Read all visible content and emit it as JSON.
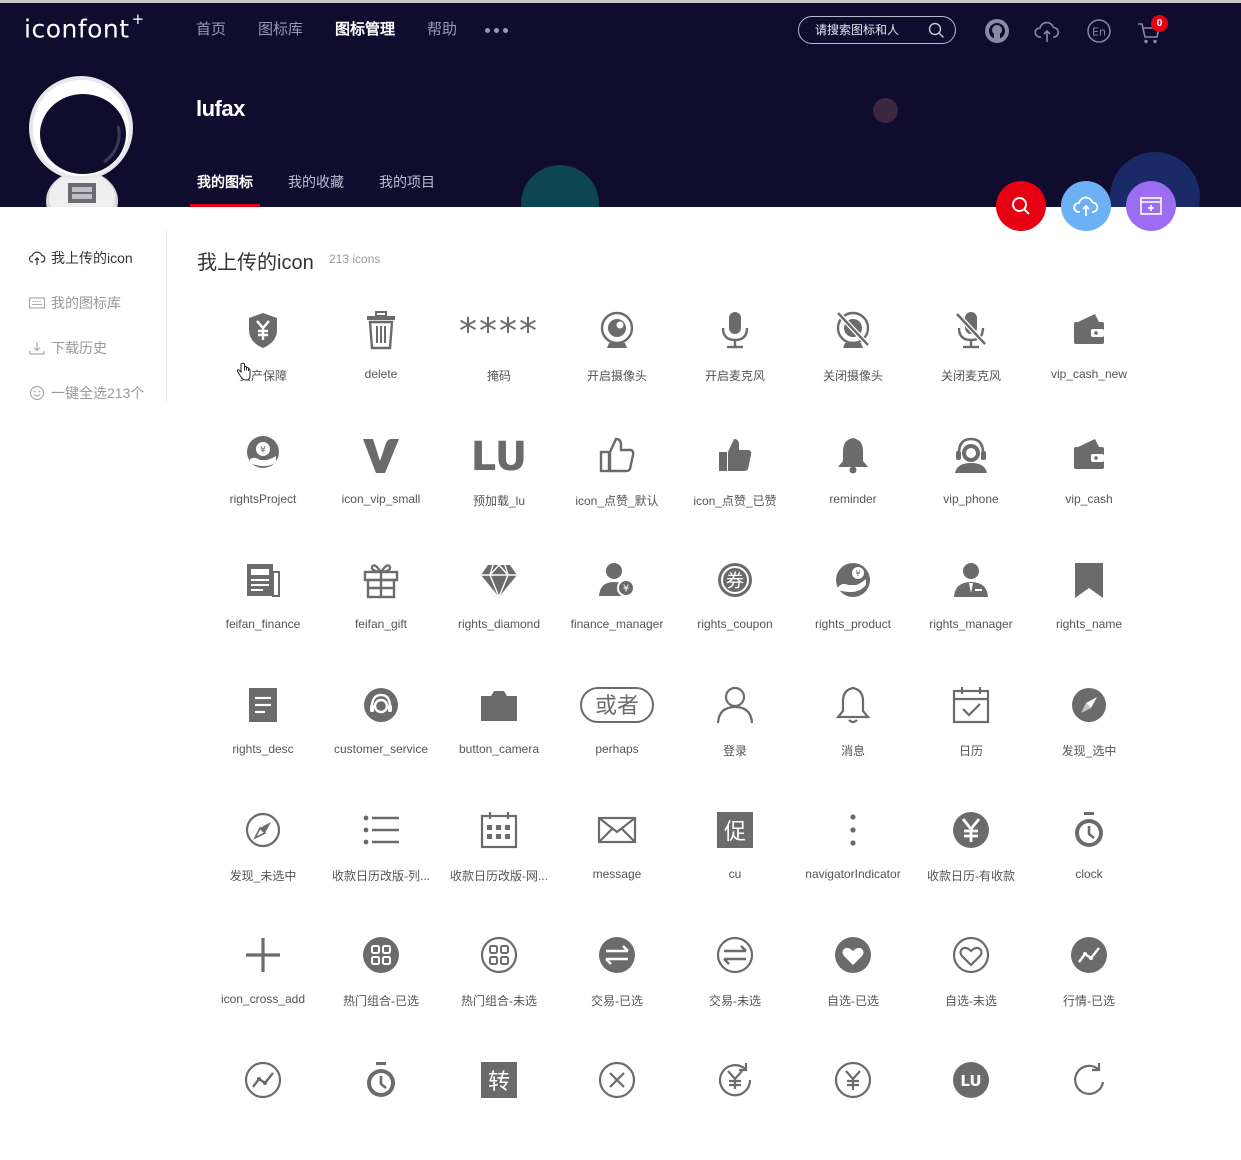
{
  "header": {
    "logo": "iconfont",
    "logo_plus": "+",
    "nav": [
      {
        "label": "首页",
        "active": false
      },
      {
        "label": "图标库",
        "active": false
      },
      {
        "label": "图标管理",
        "active": true
      },
      {
        "label": "帮助",
        "active": false
      }
    ],
    "search_placeholder": "请搜索图标和人",
    "cart_count": "0",
    "icons": [
      "user-circle-icon",
      "cloud-upload-icon",
      "language-en-icon",
      "cart-icon"
    ]
  },
  "profile": {
    "username": "lufax",
    "tabs": [
      {
        "label": "我的图标",
        "active": true
      },
      {
        "label": "我的收藏",
        "active": false
      },
      {
        "label": "我的项目",
        "active": false
      }
    ]
  },
  "fabs": [
    {
      "icon": "search-icon",
      "color": "#e60012"
    },
    {
      "icon": "cloud-upload-icon",
      "color": "#6cb0f6"
    },
    {
      "icon": "add-project-icon",
      "color": "#9c6cf2"
    }
  ],
  "sidebar": {
    "items": [
      {
        "label": "我上传的icon",
        "icon": "cloud-upload-icon",
        "active": true
      },
      {
        "label": "我的图标库",
        "icon": "keyboard-icon",
        "active": false
      },
      {
        "label": "下载历史",
        "icon": "download-icon",
        "active": false
      },
      {
        "label": "一键全选213个",
        "icon": "smile-icon",
        "active": false
      }
    ]
  },
  "main": {
    "title": "我上传的icon",
    "count": "213 icons",
    "icons": [
      {
        "label": "资产保障",
        "icon": "shield-yen-icon"
      },
      {
        "label": "delete",
        "icon": "trash-icon"
      },
      {
        "label": "掩码",
        "icon": "asterisks-icon"
      },
      {
        "label": "开启摄像头",
        "icon": "camera-on-icon"
      },
      {
        "label": "开启麦克风",
        "icon": "mic-on-icon"
      },
      {
        "label": "关闭摄像头",
        "icon": "camera-off-icon"
      },
      {
        "label": "关闭麦克风",
        "icon": "mic-off-icon"
      },
      {
        "label": "vip_cash_new",
        "icon": "wallet-icon"
      },
      {
        "label": "rightsProject",
        "icon": "hand-yen-icon"
      },
      {
        "label": "icon_vip_small",
        "icon": "vip-v-icon"
      },
      {
        "label": "预加载_lu",
        "icon": "lu-text-icon"
      },
      {
        "label": "icon_点赞_默认",
        "icon": "thumb-up-outline-icon"
      },
      {
        "label": "icon_点赞_已赞",
        "icon": "thumb-up-filled-icon"
      },
      {
        "label": "reminder",
        "icon": "bell-filled-icon"
      },
      {
        "label": "vip_phone",
        "icon": "headset-user-icon"
      },
      {
        "label": "vip_cash",
        "icon": "wallet-icon"
      },
      {
        "label": "feifan_finance",
        "icon": "newspaper-icon"
      },
      {
        "label": "feifan_gift",
        "icon": "gift-icon"
      },
      {
        "label": "rights_diamond",
        "icon": "diamond-icon"
      },
      {
        "label": "finance_manager",
        "icon": "user-yen-icon"
      },
      {
        "label": "rights_coupon",
        "icon": "coupon-icon"
      },
      {
        "label": "rights_product",
        "icon": "hand-yen-circle-icon"
      },
      {
        "label": "rights_manager",
        "icon": "manager-icon"
      },
      {
        "label": "rights_name",
        "icon": "bookmark-icon"
      },
      {
        "label": "rights_desc",
        "icon": "document-icon"
      },
      {
        "label": "customer_service",
        "icon": "headset-icon"
      },
      {
        "label": "button_camera",
        "icon": "camera-icon"
      },
      {
        "label": "perhaps",
        "icon": "perhaps-badge-icon"
      },
      {
        "label": "登录",
        "icon": "user-outline-icon"
      },
      {
        "label": "消息",
        "icon": "bell-outline-icon"
      },
      {
        "label": "日历",
        "icon": "calendar-check-icon"
      },
      {
        "label": "发现_选中",
        "icon": "compass-filled-icon"
      },
      {
        "label": "发现_未选中",
        "icon": "compass-outline-icon"
      },
      {
        "label": "收款日历改版-列...",
        "icon": "list-icon"
      },
      {
        "label": "收款日历改版-网...",
        "icon": "calendar-grid-icon"
      },
      {
        "label": "message",
        "icon": "envelope-icon"
      },
      {
        "label": "cu",
        "icon": "promo-cu-icon"
      },
      {
        "label": "navigatorIndicator",
        "icon": "vertical-dots-icon"
      },
      {
        "label": "收款日历-有收款",
        "icon": "yen-circle-filled-icon"
      },
      {
        "label": "clock",
        "icon": "stopwatch-icon"
      },
      {
        "label": "icon_cross_add",
        "icon": "plus-icon"
      },
      {
        "label": "热门组合-已选",
        "icon": "grid-circle-filled-icon"
      },
      {
        "label": "热门组合-未选",
        "icon": "grid-circle-outline-icon"
      },
      {
        "label": "交易-已选",
        "icon": "exchange-filled-icon"
      },
      {
        "label": "交易-未选",
        "icon": "exchange-outline-icon"
      },
      {
        "label": "自选-已选",
        "icon": "heart-circle-filled-icon"
      },
      {
        "label": "自选-未选",
        "icon": "heart-circle-outline-icon"
      },
      {
        "label": "行情-已选",
        "icon": "trend-circle-filled-icon"
      },
      {
        "label": "",
        "icon": "trend-circle-outline-icon"
      },
      {
        "label": "",
        "icon": "stopwatch-icon"
      },
      {
        "label": "",
        "icon": "zhuan-badge-icon"
      },
      {
        "label": "",
        "icon": "close-circle-icon"
      },
      {
        "label": "",
        "icon": "yen-refresh-icon"
      },
      {
        "label": "",
        "icon": "yen-circle-outline-icon"
      },
      {
        "label": "",
        "icon": "lu-circle-icon"
      },
      {
        "label": "",
        "icon": "refresh-icon"
      }
    ]
  }
}
